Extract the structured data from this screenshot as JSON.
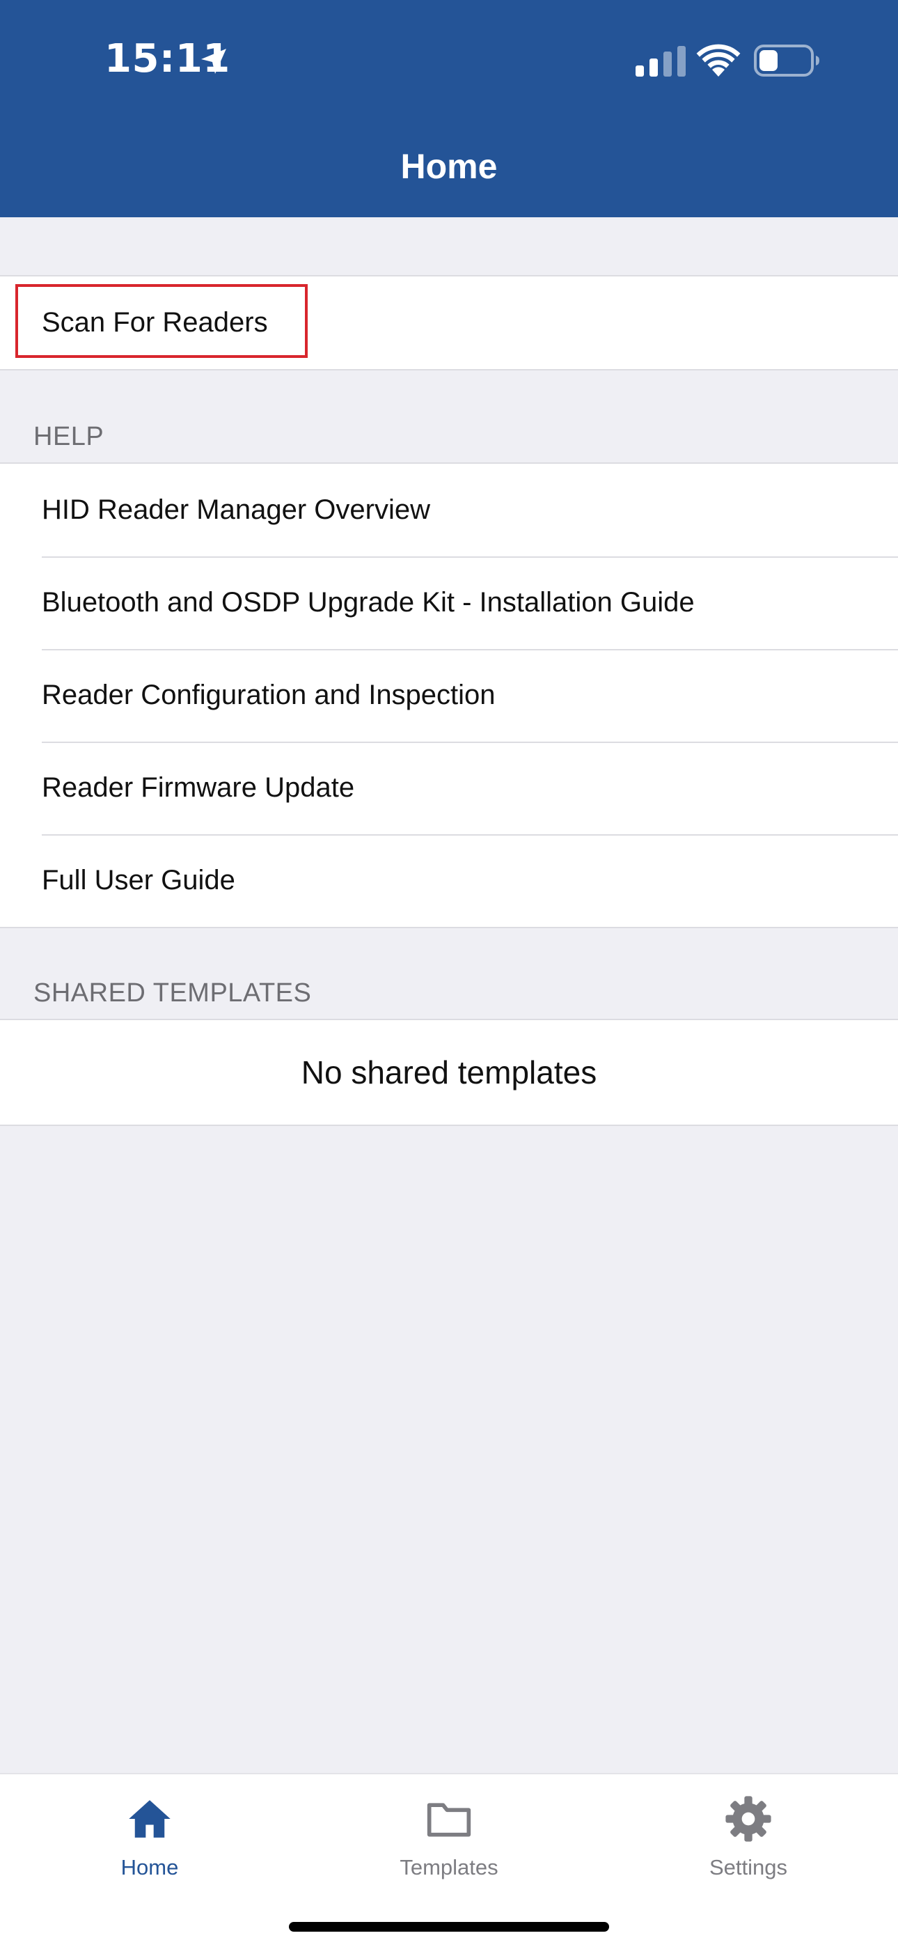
{
  "status_bar": {
    "time": "15:11"
  },
  "nav": {
    "title": "Home"
  },
  "main": {
    "scan_row": {
      "label": "Scan For Readers"
    },
    "help": {
      "header": "HELP",
      "items": [
        {
          "label": "HID Reader Manager Overview"
        },
        {
          "label": "Bluetooth and OSDP Upgrade Kit - Installation Guide"
        },
        {
          "label": "Reader Configuration and Inspection"
        },
        {
          "label": "Reader Firmware Update"
        },
        {
          "label": "Full User Guide"
        }
      ]
    },
    "shared_templates": {
      "header": "SHARED TEMPLATES",
      "empty_text": "No shared templates"
    }
  },
  "tabbar": {
    "tabs": [
      {
        "label": "Home",
        "icon": "home-icon",
        "active": true
      },
      {
        "label": "Templates",
        "icon": "folder-icon",
        "active": false
      },
      {
        "label": "Settings",
        "icon": "gear-icon",
        "active": false
      }
    ]
  },
  "colors": {
    "brand_blue": "#245497",
    "highlight_red": "#d8262d",
    "background": "#efeff4",
    "inactive_gray": "#7d7d82"
  }
}
